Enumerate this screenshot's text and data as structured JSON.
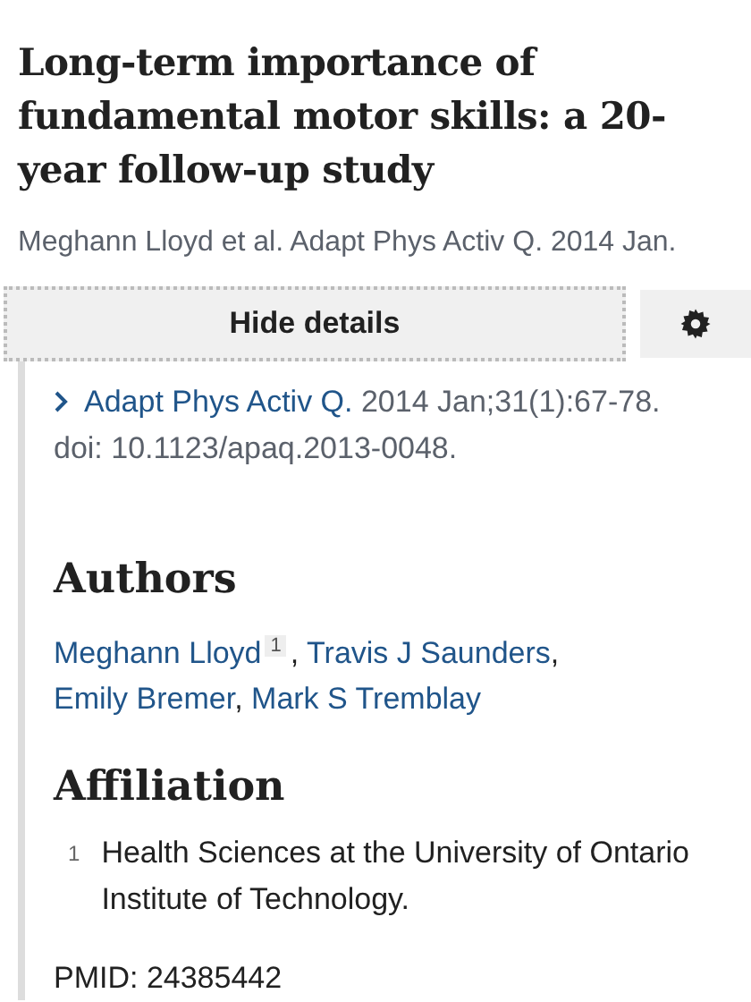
{
  "title": "Long-term importance of fundamental motor skills: a 20-year follow-up study",
  "short_citation": "Meghann Lloyd et al. Adapt Phys Activ Q. 2014 Jan.",
  "details_button": {
    "label": "Hide details"
  },
  "citation": {
    "journal": "Adapt Phys Activ Q.",
    "text": " 2014 Jan;31(1):67-78. doi: 10.1123/apaq.2013-0048."
  },
  "authors_heading": "Authors",
  "authors": [
    {
      "name": "Meghann Lloyd",
      "affiliation": "1",
      "separator": ","
    },
    {
      "name": "Travis J Saunders",
      "separator": ","
    },
    {
      "name": "Emily Bremer",
      "separator": ","
    },
    {
      "name": "Mark S Tremblay"
    }
  ],
  "affiliation_heading": "Affiliation",
  "affiliations": [
    {
      "number": "1",
      "text": "Health Sciences at the University of Ontario Institute of Technology."
    }
  ],
  "pmid": "PMID: 24385442"
}
